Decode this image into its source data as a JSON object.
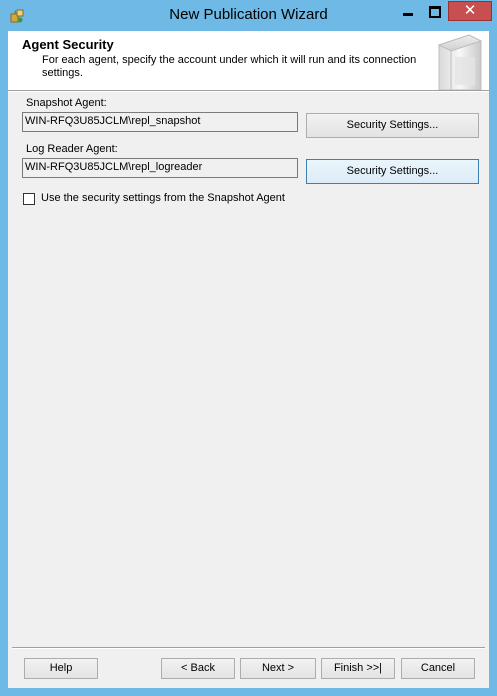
{
  "window": {
    "title": "New Publication Wizard",
    "close_glyph": "✕"
  },
  "header": {
    "title": "Agent Security",
    "description": "For each agent, specify the account under which it will run and its connection settings."
  },
  "snapshot_agent": {
    "label": "Snapshot Agent:",
    "account": "WIN-RFQ3U85JCLM\\repl_snapshot",
    "button_label": "Security Settings..."
  },
  "log_reader_agent": {
    "label": "Log Reader Agent:",
    "account": "WIN-RFQ3U85JCLM\\repl_logreader",
    "button_label": "Security Settings..."
  },
  "use_snapshot_settings": {
    "label": "Use the security settings from the Snapshot Agent",
    "checked": false
  },
  "footer": {
    "help": "Help",
    "back": "< Back",
    "next": "Next >",
    "finish": "Finish >>|",
    "cancel": "Cancel"
  },
  "colors": {
    "titlebar": "#6fb9e6",
    "close_button": "#c74f4f",
    "dialog_bg": "#f0f0f0",
    "focus_border": "#3c7fb1"
  },
  "icons": {
    "app": "wizard-app-icon",
    "header_art": "server-graphic"
  }
}
